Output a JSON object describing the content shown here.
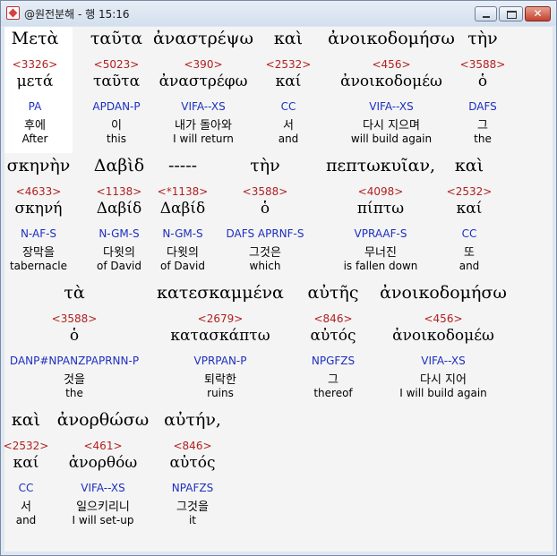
{
  "window": {
    "title": "@원전분해 - 행 15:16"
  },
  "rows": [
    {
      "words": [
        {
          "greek": "Μετὰ",
          "num": "<3326>",
          "lemma": "μετά",
          "parse": "PA",
          "kor": "후에",
          "eng": "After"
        },
        {
          "greek": "ταῦτα",
          "num": "<5023>",
          "lemma": "ταῦτα",
          "parse": "APDAN-P",
          "kor": "이",
          "eng": "this"
        },
        {
          "greek": "ἀναστρέψω",
          "num": "<390>",
          "lemma": "ἀναστρέφω",
          "parse": "VIFA--XS",
          "kor": "내가 돌아와",
          "eng": "I will return"
        },
        {
          "greek": "καὶ",
          "num": "<2532>",
          "lemma": "καί",
          "parse": "CC",
          "kor": "서",
          "eng": "and"
        },
        {
          "greek": "ἀνοικοδομήσω",
          "num": "<456>",
          "lemma": "ἀνοικοδομέω",
          "parse": "VIFA--XS",
          "kor": "다시 지으며",
          "eng": "will build again"
        },
        {
          "greek": "τὴν",
          "num": "<3588>",
          "lemma": "ὁ",
          "parse": "DAFS",
          "kor": "그",
          "eng": "the"
        }
      ]
    },
    {
      "words": [
        {
          "greek": "σκηνὴν",
          "num": "<4633>",
          "lemma": "σκηνή",
          "parse": "N-AF-S",
          "kor": "장막을",
          "eng": "tabernacle"
        },
        {
          "greek": "Δαβὶδ",
          "num": "<1138>",
          "lemma": "Δαβίδ",
          "parse": "N-GM-S",
          "kor": "다윗의",
          "eng": "of David"
        },
        {
          "greek": "-----",
          "num": "<*1138>",
          "lemma": "Δαβίδ",
          "parse": "N-GM-S",
          "kor": "다윗의",
          "eng": "of David"
        },
        {
          "greek": "τὴν",
          "num": "<3588>",
          "lemma": "ὁ",
          "parse": "DAFS APRNF-S",
          "kor": "그것은",
          "eng": "which"
        },
        {
          "greek": "πεπτωκυῖαν,",
          "num": "<4098>",
          "lemma": "πίπτω",
          "parse": "VPRAAF-S",
          "kor": "무너진",
          "eng": "is fallen down"
        },
        {
          "greek": "καὶ",
          "num": "<2532>",
          "lemma": "καί",
          "parse": "CC",
          "kor": "또",
          "eng": "and"
        }
      ]
    },
    {
      "words": [
        {
          "greek": "τὰ",
          "num": "<3588>",
          "lemma": "ὁ",
          "parse": "DANP#NPANZPAPRNN-P",
          "kor": "것을",
          "eng": "the"
        },
        {
          "greek": "κατεσκαμμένα",
          "num": "<2679>",
          "lemma": "κατασκάπτω",
          "parse": "VPRPAN-P",
          "kor": "퇴락한",
          "eng": "ruins"
        },
        {
          "greek": "αὐτῆς",
          "num": "<846>",
          "lemma": "αὐτός",
          "parse": "NPGFZS",
          "kor": "그",
          "eng": "thereof"
        },
        {
          "greek": "ἀνοικοδομήσω",
          "num": "<456>",
          "lemma": "ἀνοικοδομέω",
          "parse": "VIFA--XS",
          "kor": "다시 지어",
          "eng": "I will build again"
        }
      ]
    },
    {
      "words": [
        {
          "greek": "καὶ",
          "num": "<2532>",
          "lemma": "καί",
          "parse": "CC",
          "kor": "서",
          "eng": "and"
        },
        {
          "greek": "ἀνορθώσω",
          "num": "<461>",
          "lemma": "ἀνορθόω",
          "parse": "VIFA--XS",
          "kor": "일으키리니",
          "eng": "I will set-up"
        },
        {
          "greek": "αὐτήν,",
          "num": "<846>",
          "lemma": "αὐτός",
          "parse": "NPAFZS",
          "kor": "그것을",
          "eng": "it"
        }
      ]
    }
  ]
}
